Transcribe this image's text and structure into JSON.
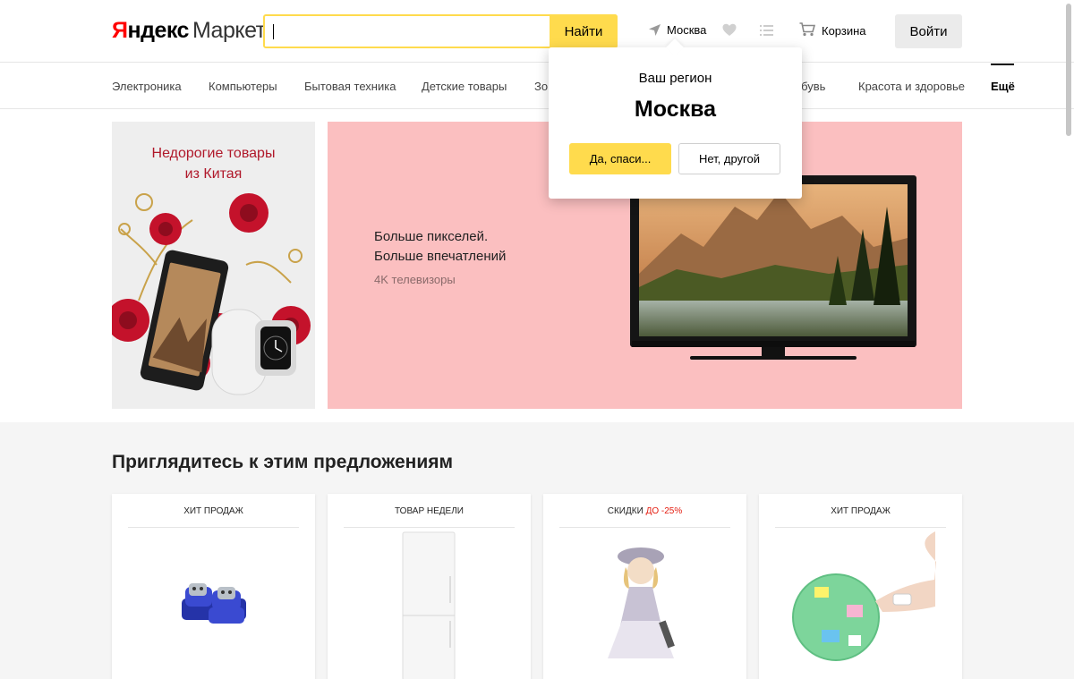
{
  "header": {
    "logo_yandex": "Яндекс",
    "logo_market": "Маркет",
    "search_placeholder": "",
    "search_button": "Найти",
    "region": "Москва",
    "cart": "Корзина",
    "login": "Войти"
  },
  "categories": [
    "Электроника",
    "Компьютеры",
    "Бытовая техника",
    "Детские товары",
    "Зо",
    "Обувь",
    "Красота и здоровье",
    "Ещё"
  ],
  "banner_left": {
    "title_line1": "Недорогие товары",
    "title_line2": "из Китая"
  },
  "banner_main": {
    "line1": "Больше пикселей.",
    "line2": "Больше впечатлений",
    "sub": "4K телевизоры"
  },
  "popup": {
    "title": "Ваш регион",
    "city": "Москва",
    "yes": "Да, спаси...",
    "no": "Нет, другой"
  },
  "offers": {
    "title": "Приглядитесь к этим предложениям",
    "cards": [
      {
        "label": "Хит продаж",
        "extra": ""
      },
      {
        "label": "Товар недели",
        "extra": ""
      },
      {
        "label": "Скидки",
        "extra": "до -25%"
      },
      {
        "label": "Хит продаж",
        "extra": ""
      }
    ]
  },
  "colors": {
    "accent": "#ffdb4d",
    "logo_red": "#ff0000",
    "banner_pink": "#fbbfc0",
    "discount_red": "#e41b0e"
  }
}
